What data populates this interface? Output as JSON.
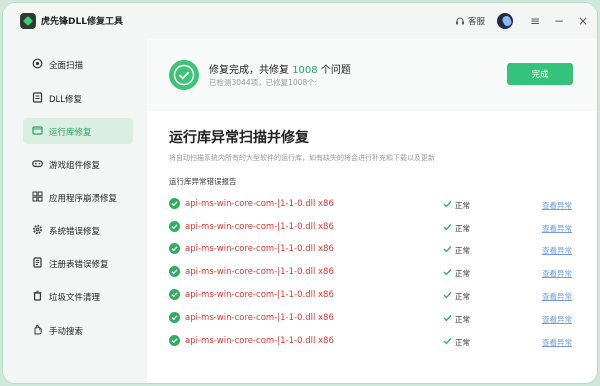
{
  "app": {
    "title": "虎先锋DLL修复工具"
  },
  "titlebar": {
    "support_label": "客服",
    "menu_icon": "menu-icon",
    "minimize_icon": "minimize-icon",
    "close_icon": "close-icon"
  },
  "sidebar": {
    "items": [
      {
        "label": "全面扫描",
        "icon": "scan-icon",
        "active": false
      },
      {
        "label": "DLL修复",
        "icon": "dll-icon",
        "active": false
      },
      {
        "label": "运行库修复",
        "icon": "runtime-icon",
        "active": true
      },
      {
        "label": "游戏组件修复",
        "icon": "gamepad-icon",
        "active": false
      },
      {
        "label": "应用程序崩溃修复",
        "icon": "app-grid-icon",
        "active": false
      },
      {
        "label": "系统错误修复",
        "icon": "gear-icon",
        "active": false
      },
      {
        "label": "注册表错误修复",
        "icon": "registry-icon",
        "active": false
      },
      {
        "label": "垃圾文件清理",
        "icon": "trash-icon",
        "active": false
      },
      {
        "label": "手动搜索",
        "icon": "hand-icon",
        "active": false
      }
    ]
  },
  "banner": {
    "title_prefix": "修复完成，共修复 ",
    "count": "1008",
    "title_suffix": " 个问题",
    "subtitle": "已检测3044项，已修复1008个:",
    "complete_button": "完成"
  },
  "section": {
    "title": "运行库异常扫描并修复",
    "description": "将自动扫描系统内所有的大型软件的运行库，如有缺失的将会进行补充和下载以及更新",
    "report_label": "运行库异常错误报告"
  },
  "rows": [
    {
      "file": "api-ms-win-core-com-|1-1-0.dll x86",
      "status": "正常",
      "detail": "查看异常"
    },
    {
      "file": "api-ms-win-core-com-|1-1-0.dll x86",
      "status": "正常",
      "detail": "查看异常"
    },
    {
      "file": "api-ms-win-core-com-|1-1-0.dll x86",
      "status": "正常",
      "detail": "查看异常"
    },
    {
      "file": "api-ms-win-core-com-|1-1-0.dll x86",
      "status": "正常",
      "detail": "查看异常"
    },
    {
      "file": "api-ms-win-core-com-|1-1-0.dll x86",
      "status": "正常",
      "detail": "查看异常"
    },
    {
      "file": "api-ms-win-core-com-|1-1-0.dll x86",
      "status": "正常",
      "detail": "查看异常"
    },
    {
      "file": "api-ms-win-core-com-|1-1-0.dll x86",
      "status": "正常",
      "detail": "查看异常"
    }
  ],
  "colors": {
    "accent": "#35c27a",
    "error_text": "#e2352d",
    "link": "#6f9ae6",
    "active_bg": "#dbeee4"
  }
}
